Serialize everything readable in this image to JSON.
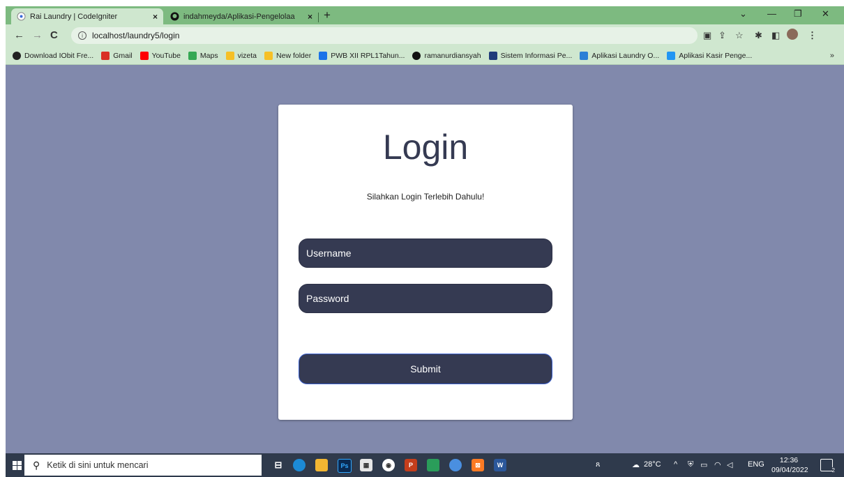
{
  "browser": {
    "tabs": [
      {
        "title": "Rai Laundry | CodeIgniter",
        "close": "×"
      },
      {
        "title": "indahmeyda/Aplikasi-Pengelolaa",
        "close": "×"
      }
    ],
    "new_tab": "+",
    "url": "localhost/laundry5/login",
    "bookmarks": [
      {
        "label": "Download IObit Fre...",
        "color": "#222222"
      },
      {
        "label": "Gmail",
        "color": "#d93025"
      },
      {
        "label": "YouTube",
        "color": "#ff0000"
      },
      {
        "label": "Maps",
        "color": "#34a853"
      },
      {
        "label": "vizeta",
        "color": "#f6c026"
      },
      {
        "label": "New folder",
        "color": "#f6c026"
      },
      {
        "label": "PWB XII RPL1Tahun...",
        "color": "#1a73e8"
      },
      {
        "label": "ramanurdiansyah",
        "color": "#111111"
      },
      {
        "label": "Sistem Informasi Pe...",
        "color": "#1f3b7a"
      },
      {
        "label": "Aplikasi Laundry O...",
        "color": "#2b7fd6"
      },
      {
        "label": "Aplikasi Kasir Penge...",
        "color": "#2196f3"
      }
    ],
    "more": "»"
  },
  "login": {
    "title": "Login",
    "subtitle": "Silahkan Login Terlebih Dahulu!",
    "username_placeholder": "Username",
    "password_placeholder": "Password",
    "submit_label": "Submit"
  },
  "taskbar": {
    "search_placeholder": "Ketik di sini untuk mencari",
    "weather": "28°C",
    "lang": "ENG",
    "time": "12:36",
    "date": "09/04/2022",
    "notifications": "2"
  },
  "colors": {
    "page_bg": "#8189ac",
    "card_bg": "#ffffff",
    "field_bg": "#353a52",
    "tab_bar": "#7dba80"
  }
}
